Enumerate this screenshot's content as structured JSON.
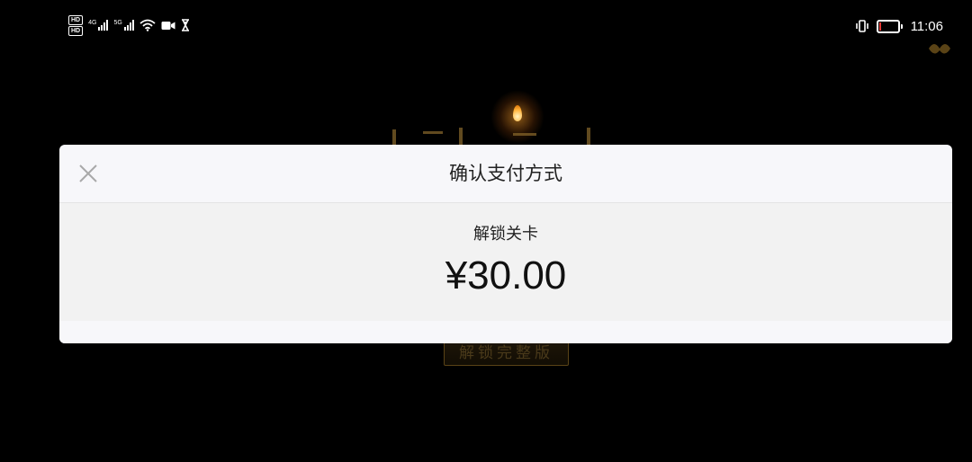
{
  "status_bar": {
    "left_icons": [
      "hd-icon",
      "4g-signal-icon",
      "5g-signal-icon",
      "wifi-icon",
      "video-camera-icon",
      "hourglass-icon"
    ],
    "network_1": "4G",
    "network_2": "5G",
    "hd_label": "HD",
    "right_icons": [
      "vibrate-icon",
      "battery-icon"
    ],
    "battery_level": 0.12,
    "battery_color": "#e53935",
    "time": "11:06"
  },
  "modal": {
    "title": "确认支付方式",
    "close_icon": "close-icon",
    "item_name": "解锁关卡",
    "price": "¥30.00"
  },
  "background": {
    "button_label": "解锁完整版",
    "accent_color": "#8a6a2c"
  }
}
